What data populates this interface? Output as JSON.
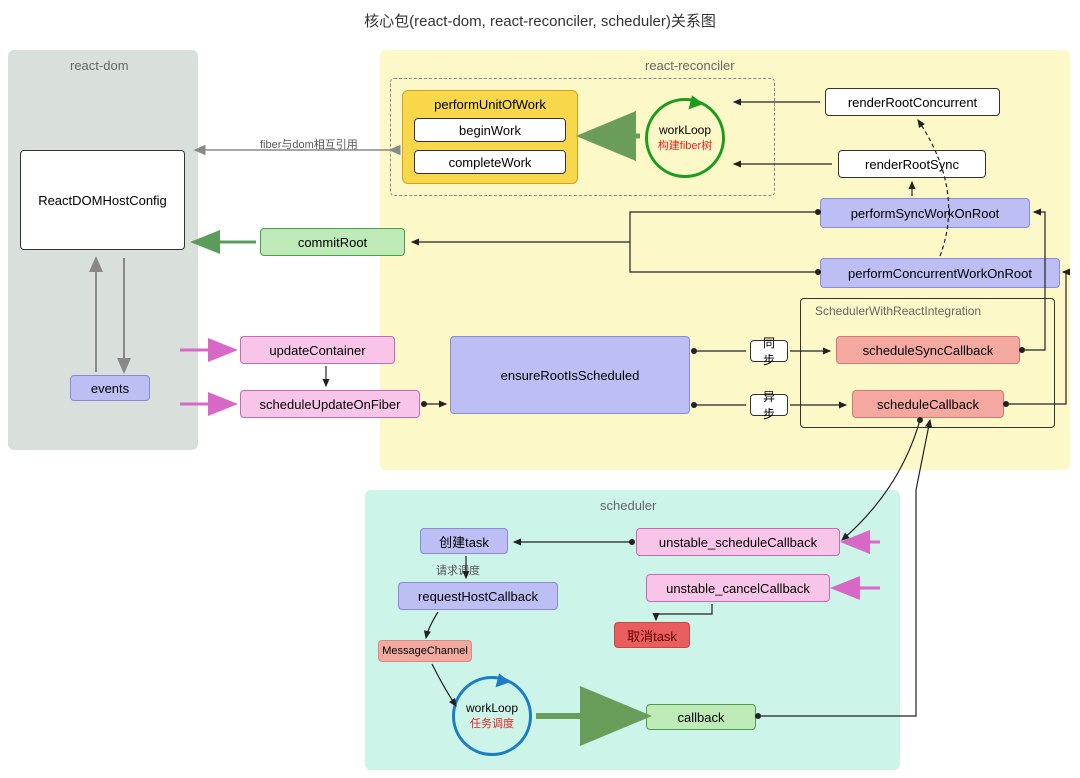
{
  "title": "核心包(react-dom, react-reconciler, scheduler)关系图",
  "panels": {
    "react_dom": "react-dom",
    "react_reconciler": "react-reconciler",
    "scheduler": "scheduler"
  },
  "boxes": {
    "reactDomHostConfig": "ReactDOMHostConfig",
    "events": "events",
    "commitRoot": "commitRoot",
    "updateContainer": "updateContainer",
    "scheduleUpdateOnFiber": "scheduleUpdateOnFiber",
    "performUnitOfWork": "performUnitOfWork",
    "beginWork": "beginWork",
    "completeWork": "completeWork",
    "workLoop1": "workLoop",
    "workLoop1_sub": "构建fiber树",
    "renderRootConcurrent": "renderRootConcurrent",
    "renderRootSync": "renderRootSync",
    "performSyncWorkOnRoot": "performSyncWorkOnRoot",
    "performConcurrentWorkOnRoot": "performConcurrentWorkOnRoot",
    "schedulerWithReactIntegration": "SchedulerWithReactIntegration",
    "scheduleSyncCallback": "scheduleSyncCallback",
    "scheduleCallback": "scheduleCallback",
    "ensureRootIsScheduled": "ensureRootIsScheduled",
    "sync": "同步",
    "async": "异步",
    "createTask": "创建task",
    "requestScheduling": "请求调度",
    "requestHostCallback": "requestHostCallback",
    "messageChannel": "MessageChannel",
    "workLoop2": "workLoop",
    "workLoop2_sub": "任务调度",
    "callback": "callback",
    "unstableScheduleCallback": "unstable_scheduleCallback",
    "unstableCancelCallback": "unstable_cancelCallback",
    "cancelTask": "取消task"
  },
  "labels": {
    "fiberDom": "fiber与dom相互引用"
  },
  "colors": {
    "pinkArrow": "#d868c5",
    "greenArrow": "#5a9d5a",
    "grayArrow": "#888",
    "blackArrow": "#222"
  }
}
